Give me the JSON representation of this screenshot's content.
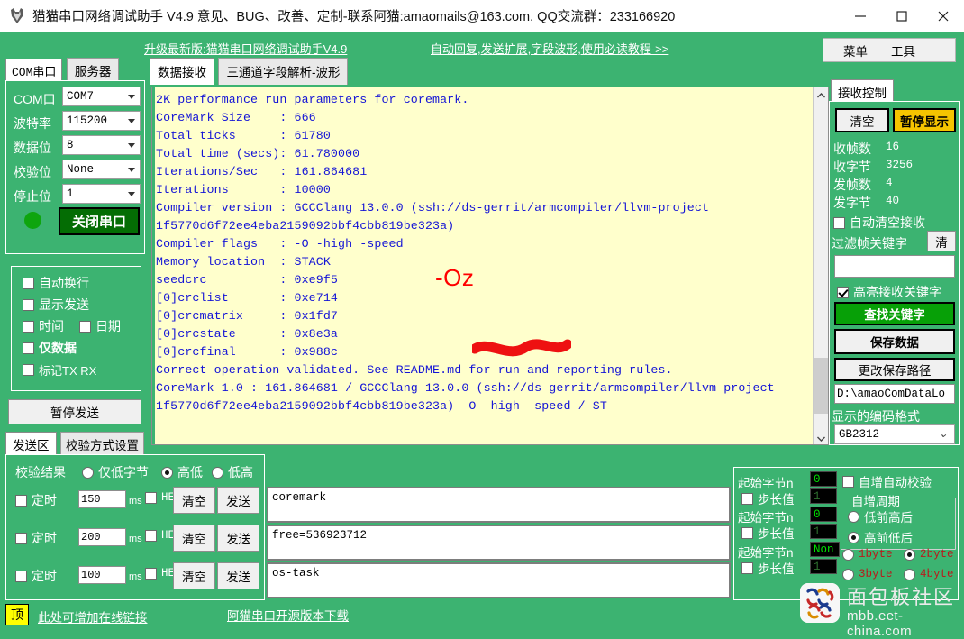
{
  "window": {
    "title": "猫猫串口网络调试助手 V4.9 意见、BUG、改善、定制-联系阿猫:amaomails@163.com. QQ交流群：233166920",
    "minimize": "—",
    "maximize": "□",
    "close": "✕"
  },
  "banner": {
    "link_upgrade": "升级最新版:猫猫串口网络调试助手V4.9",
    "link_tutorial": "自动回复,发送扩展,字段波形,使用必读教程->>",
    "menu": "菜单",
    "tools": "工具"
  },
  "left_tabs": {
    "com": "COM串口",
    "server": "服务器"
  },
  "serial": {
    "labels": {
      "port": "COM口",
      "baud": "波特率",
      "data": "数据位",
      "parity": "校验位",
      "stop": "停止位"
    },
    "values": {
      "port": "COM7",
      "baud": "115200",
      "data": "8",
      "parity": "None",
      "stop": "1"
    },
    "close_button": "关闭串口",
    "status_color": "#0ea50e"
  },
  "display_options": {
    "auto_newline": {
      "label": "自动换行",
      "checked": false
    },
    "show_send": {
      "label": "显示发送",
      "checked": false
    },
    "time": {
      "label": "时间",
      "checked": false
    },
    "date": {
      "label": "日期",
      "checked": false
    },
    "data_only": {
      "label": "仅数据",
      "checked": false
    },
    "mark_txrx": {
      "label": "标记TX RX",
      "checked": false
    }
  },
  "pause_send_button": "暂停发送",
  "send_tabs": {
    "send_area": "发送区",
    "checksum_settings": "校验方式设置"
  },
  "checksum": {
    "result_label": "校验结果",
    "options": [
      {
        "label": "仅低字节",
        "selected": false
      },
      {
        "label": "高低",
        "selected": true
      },
      {
        "label": "低高",
        "selected": false
      }
    ]
  },
  "timers": [
    {
      "timer_label": "定时",
      "interval": "150",
      "unit": "ms",
      "hex": "HEX",
      "hex_checked": false,
      "timer_checked": false,
      "clear": "清空",
      "send": "发送"
    },
    {
      "timer_label": "定时",
      "interval": "200",
      "unit": "ms",
      "hex": "HEX",
      "hex_checked": false,
      "timer_checked": false,
      "clear": "清空",
      "send": "发送"
    },
    {
      "timer_label": "定时",
      "interval": "100",
      "unit": "ms",
      "hex": "HEX",
      "hex_checked": false,
      "timer_checked": false,
      "clear": "清空",
      "send": "发送"
    }
  ],
  "main_tabs": {
    "data_recv": "数据接收",
    "three_channel": "三通道字段解析-波形"
  },
  "terminal": {
    "text": "2K performance run parameters for coremark.\nCoreMark Size    : 666\nTotal ticks      : 61780\nTotal time (secs): 61.780000\nIterations/Sec   : 161.864681\nIterations       : 10000\nCompiler version : GCCClang 13.0.0 (ssh://ds-gerrit/armcompiler/llvm-project\n1f5770d6f72ee4eba2159092bbf4cbb819be323a)\nCompiler flags   : -O -high -speed\nMemory location  : STACK\nseedcrc          : 0xe9f5\n[0]crclist       : 0xe714\n[0]crcmatrix     : 0x1fd7\n[0]crcstate      : 0x8e3a\n[0]crcfinal      : 0x988c\nCorrect operation validated. See README.md for run and reporting rules.\nCoreMark 1.0 : 161.864681 / GCCClang 13.0.0 (ssh://ds-gerrit/armcompiler/llvm-project\n1f5770d6f72ee4eba2159092bbf4cbb819be323a) -O -high -speed / ST",
    "annotation": "-Oz",
    "annotation_color": "#ff0000",
    "bg_color": "#ffffcc",
    "text_color": "#1414d6"
  },
  "recv_control": {
    "tab": "接收控制",
    "clear_button": "清空",
    "pause_display_button": "暂停显示",
    "stats": [
      {
        "label": "收帧数",
        "value": "16"
      },
      {
        "label": "收字节",
        "value": "3256"
      },
      {
        "label": "发帧数",
        "value": "4"
      },
      {
        "label": "发字节",
        "value": "40"
      }
    ],
    "auto_clear": {
      "label": "自动清空接收",
      "checked": false
    },
    "filter_label": "过滤帧关键字",
    "filter_clear_button": "清",
    "filter_value": "",
    "highlight": {
      "label": "高亮接收关键字",
      "checked": true
    },
    "find_keyword_button": "查找关键字",
    "save_data_button": "保存数据",
    "change_path_button": "更改保存路径",
    "save_path": "D:\\amaoComDataLo",
    "encoding_label": "显示的编码格式",
    "encoding_value": "GB2312"
  },
  "send_lines": [
    {
      "text": "coremark"
    },
    {
      "text": "free=536923712"
    },
    {
      "text": "os-task"
    }
  ],
  "auto_increment": {
    "rows": [
      {
        "start_label": "起始字节n",
        "start_value": "0",
        "step_label": "步长值",
        "step_value": "1",
        "step_checked": false
      },
      {
        "start_label": "起始字节n",
        "start_value": "0",
        "step_label": "步长值",
        "step_value": "1",
        "step_checked": false
      },
      {
        "start_label": "起始字节n",
        "start_value": "Non",
        "step_label": "步长值",
        "step_value": "1",
        "step_checked": false
      }
    ],
    "auto_verify": {
      "label": "自增自动校验",
      "checked": false
    },
    "period_caption": "自增周期",
    "order_options": [
      {
        "label": "低前高后",
        "selected": false
      },
      {
        "label": "高前低后",
        "selected": true
      }
    ],
    "byte_options": [
      {
        "label": "1byte",
        "selected": false
      },
      {
        "label": "2byte",
        "selected": true
      },
      {
        "label": "3byte",
        "selected": false
      },
      {
        "label": "4byte",
        "selected": false
      }
    ]
  },
  "footer": {
    "top_badge": "顶",
    "link_online": "此处可增加在线链接",
    "link_opensource": "阿猫串口开源版本下载"
  },
  "watermark": {
    "cn": "面包板社区",
    "en": "mbb.eet-china.com"
  }
}
